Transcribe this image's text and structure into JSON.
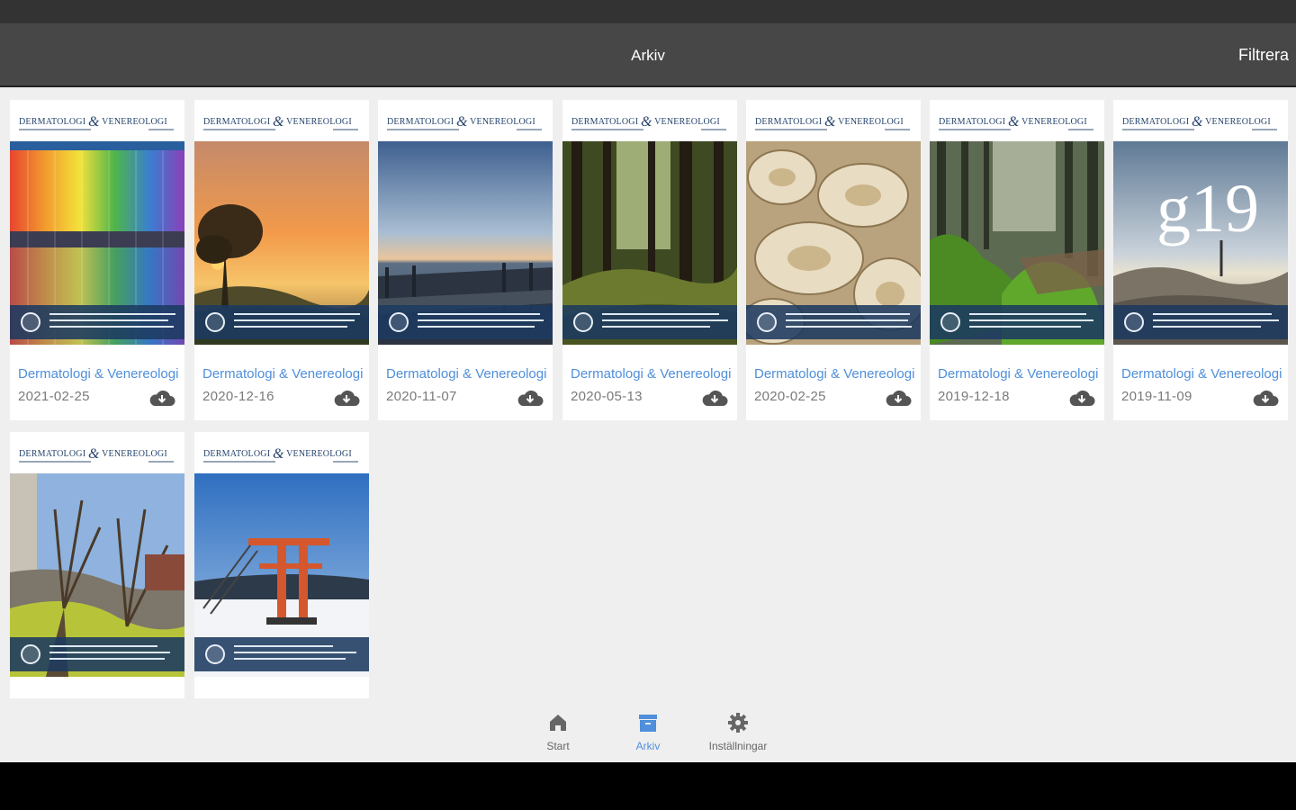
{
  "appbar": {
    "title": "Arkiv",
    "filter_label": "Filtrera"
  },
  "masthead": {
    "left": "DERMATOLOGI",
    "amp": "&",
    "right": "VENEREOLOGI"
  },
  "issues": [
    {
      "title": "Dermatologi & Venereologi",
      "date": "2021-02-25",
      "cover": "rainbow-glass-building"
    },
    {
      "title": "Dermatologi & Venereologi",
      "date": "2020-12-16",
      "cover": "sunset-tree"
    },
    {
      "title": "Dermatologi & Venereologi",
      "date": "2020-11-07",
      "cover": "pier-at-dawn"
    },
    {
      "title": "Dermatologi & Venereologi",
      "date": "2020-05-13",
      "cover": "forest-sunlight"
    },
    {
      "title": "Dermatologi & Venereologi",
      "date": "2020-02-25",
      "cover": "coral-closeup"
    },
    {
      "title": "Dermatologi & Venereologi",
      "date": "2019-12-18",
      "cover": "mossy-forest"
    },
    {
      "title": "Dermatologi & Venereologi",
      "date": "2019-11-09",
      "cover": "g19-coastline",
      "cover_text": "g19"
    },
    {
      "title": "",
      "date": "",
      "cover": "spring-trees"
    },
    {
      "title": "",
      "date": "",
      "cover": "diving-tower-snow"
    }
  ],
  "icons": {
    "download": "cloud-download-icon"
  },
  "nav": [
    {
      "label": "Start",
      "icon": "home-icon",
      "active": false
    },
    {
      "label": "Arkiv",
      "icon": "archive-icon",
      "active": true
    },
    {
      "label": "Inställningar",
      "icon": "gear-icon",
      "active": false
    }
  ],
  "colors": {
    "accent": "#4f8fdb",
    "appbar": "#474747",
    "band": "#1c3a60"
  }
}
